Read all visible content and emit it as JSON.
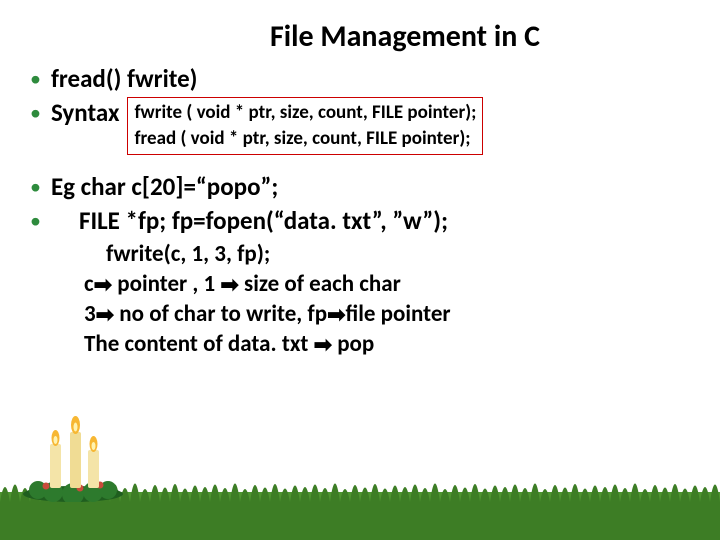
{
  "title": "File Management in C",
  "line1": "fread()  fwrite)",
  "line2_label": "Syntax",
  "syntax1": "fwrite ( void * ptr, size, count, FILE pointer);",
  "syntax2": "fread ( void * ptr, size, count, FILE pointer);",
  "line3": "Eg char c[20]=“popo”;",
  "line4": "FILE *fp; fp=fopen(“data. txt”, ”w”);",
  "sub1": "fwrite(c, 1, 3, fp);",
  "sub2_a": "c",
  "sub2_b": " pointer , 1 ",
  "sub2_c": " size of each char",
  "sub3_a": "3",
  "sub3_b": " no of char to write,  fp",
  "sub3_c": "file pointer",
  "sub4_a": "The content of data. txt ",
  "sub4_b": " pop",
  "bullet_char": "•",
  "arrow_char": "➡"
}
